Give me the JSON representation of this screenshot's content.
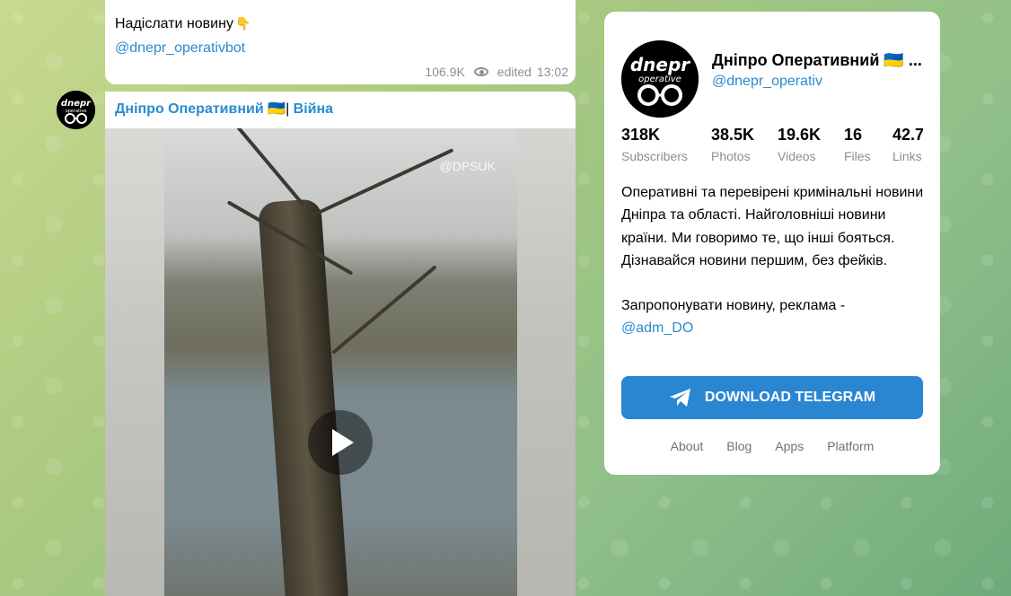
{
  "feed": {
    "message1": {
      "text": "Надіслати новину",
      "emoji": "👇",
      "link": "@dnepr_operativbot",
      "views": "106.9K",
      "edited": "edited",
      "time": "13:02"
    },
    "message2": {
      "author_name": "Дніпро Оперативний 🇺🇦",
      "author_sep": "|",
      "author_tag": "Війна",
      "video_watermark": "@DPSUK"
    }
  },
  "channel": {
    "avatar_text_top": "dnepr",
    "avatar_text_bottom": "operative",
    "title": "Дніпро Оперативний 🇺🇦 ...",
    "handle": "@dnepr_operativ",
    "stats": [
      {
        "value": "318K",
        "label": "Subscribers"
      },
      {
        "value": "38.5K",
        "label": "Photos"
      },
      {
        "value": "19.6K",
        "label": "Videos"
      },
      {
        "value": "16",
        "label": "Files"
      },
      {
        "value": "42.7",
        "label": "Links"
      }
    ],
    "description": "Оперативні та перевірені кримінальні новини Дніпра та області. Найголовніші новини країни. Ми говоримо те, що інші бояться. Дізнавайся новини першим, без фейків.",
    "suggest": "Запропонувати новину, реклама -",
    "suggest_link": "@adm_DO",
    "download_button": "DOWNLOAD TELEGRAM",
    "footer_links": [
      "About",
      "Blog",
      "Apps",
      "Platform"
    ]
  },
  "colors": {
    "accent": "#2a8bd0",
    "button": "#2b86d1",
    "muted": "#8a8f94"
  }
}
